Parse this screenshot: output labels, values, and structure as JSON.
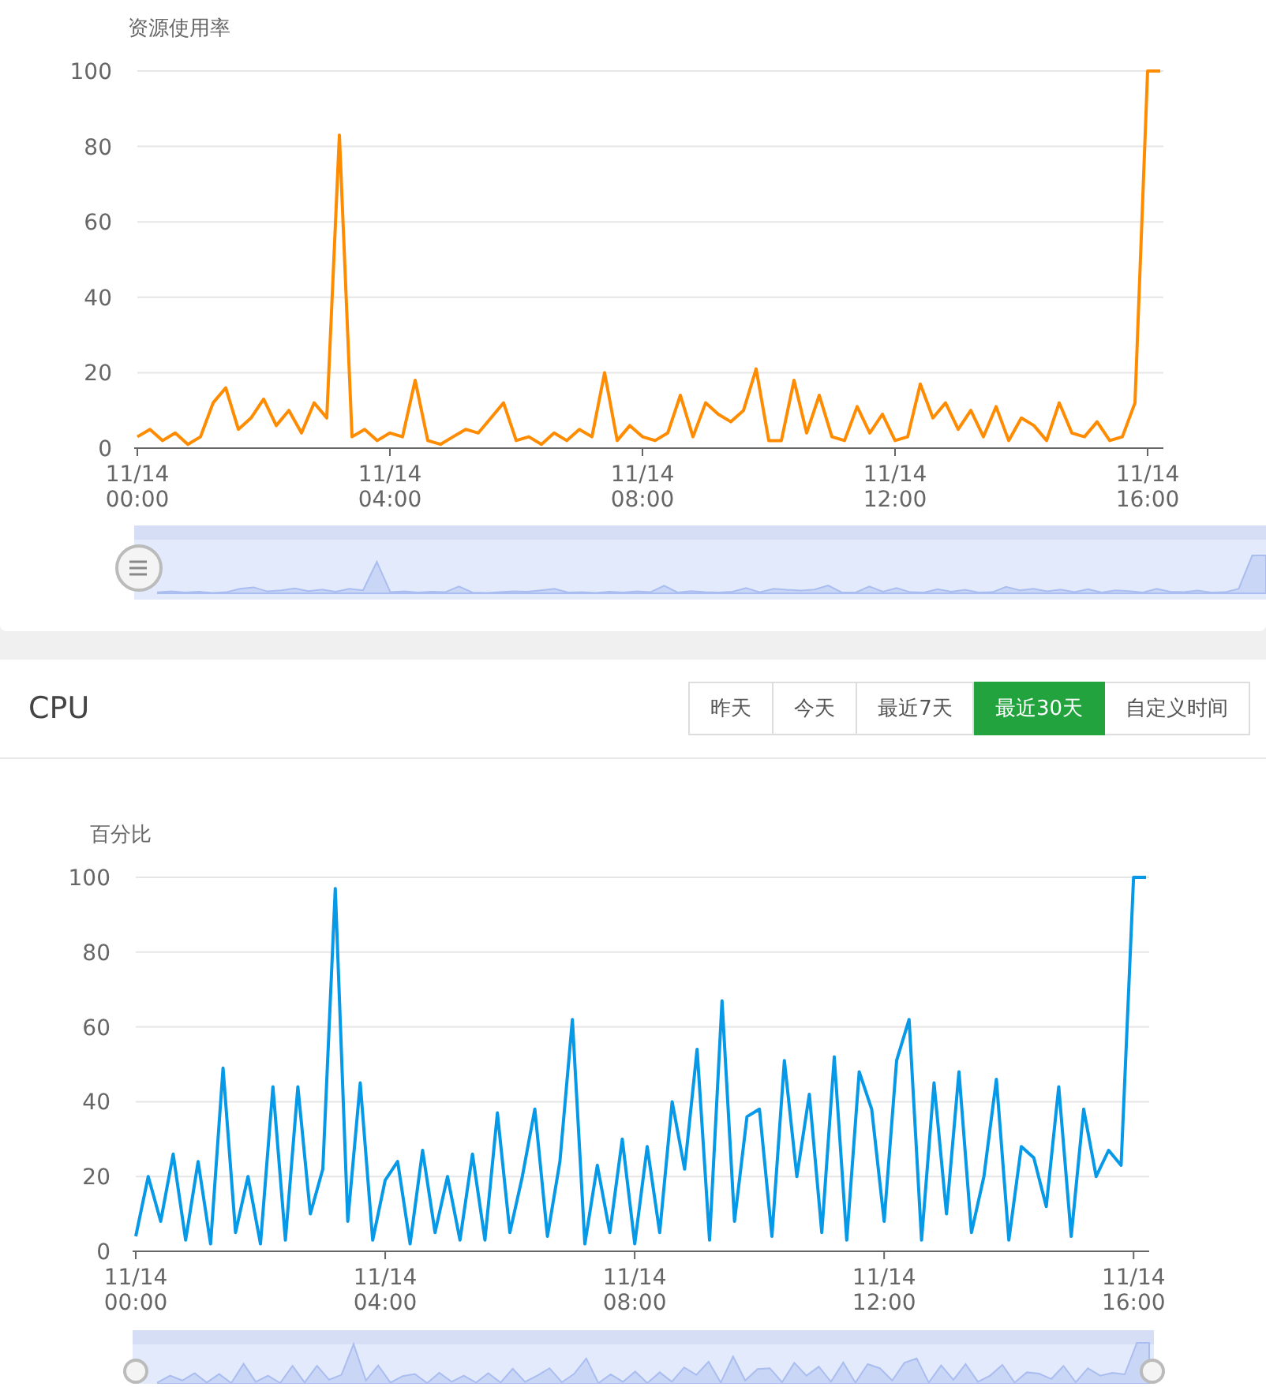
{
  "usage_panel": {
    "chart_data": {
      "type": "line",
      "ylabel": "资源使用率",
      "ylim": [
        0,
        100
      ],
      "grid": true,
      "yticks": [
        0,
        20,
        40,
        60,
        80,
        100
      ],
      "categories": [
        "11/14 00:00",
        null,
        null,
        null,
        null,
        null,
        null,
        null,
        null,
        null,
        null,
        null,
        null,
        null,
        null,
        null,
        null,
        null,
        null,
        null,
        "11/14 04:00",
        null,
        null,
        null,
        null,
        null,
        null,
        null,
        null,
        null,
        null,
        null,
        null,
        null,
        null,
        null,
        null,
        null,
        null,
        null,
        "11/14 08:00",
        null,
        null,
        null,
        null,
        null,
        null,
        null,
        null,
        null,
        null,
        null,
        null,
        null,
        null,
        null,
        null,
        null,
        null,
        null,
        "11/14 12:00",
        null,
        null,
        null,
        null,
        null,
        null,
        null,
        null,
        null,
        null,
        null,
        null,
        null,
        null,
        null,
        null,
        null,
        null,
        null,
        "11/14 16:00",
        null
      ],
      "series": [
        {
          "color": "#ff8c00",
          "values": [
            3,
            5,
            2,
            4,
            1,
            3,
            12,
            16,
            5,
            8,
            13,
            6,
            10,
            4,
            12,
            8,
            83,
            3,
            5,
            2,
            4,
            3,
            18,
            2,
            1,
            3,
            5,
            4,
            8,
            12,
            2,
            3,
            1,
            4,
            2,
            5,
            3,
            20,
            2,
            6,
            3,
            2,
            4,
            14,
            3,
            12,
            9,
            7,
            10,
            21,
            2,
            2,
            18,
            4,
            14,
            3,
            2,
            11,
            4,
            9,
            2,
            3,
            17,
            8,
            12,
            5,
            10,
            3,
            11,
            2,
            8,
            6,
            2,
            12,
            4,
            3,
            7,
            2,
            3,
            12,
            100,
            100
          ]
        }
      ]
    }
  },
  "cpu_panel": {
    "title": "CPU",
    "range_buttons": [
      {
        "label": "昨天",
        "selected": false
      },
      {
        "label": "今天",
        "selected": false
      },
      {
        "label": "最近7天",
        "selected": false
      },
      {
        "label": "最近30天",
        "selected": true
      },
      {
        "label": "自定义时间",
        "selected": false
      }
    ],
    "chart_data": {
      "type": "line",
      "ylabel": "百分比",
      "ylim": [
        0,
        100
      ],
      "grid": true,
      "yticks": [
        0,
        20,
        40,
        60,
        80,
        100
      ],
      "categories": [
        "11/14 00:00",
        null,
        null,
        null,
        null,
        null,
        null,
        null,
        null,
        null,
        null,
        null,
        null,
        null,
        null,
        null,
        null,
        null,
        null,
        null,
        "11/14 04:00",
        null,
        null,
        null,
        null,
        null,
        null,
        null,
        null,
        null,
        null,
        null,
        null,
        null,
        null,
        null,
        null,
        null,
        null,
        null,
        "11/14 08:00",
        null,
        null,
        null,
        null,
        null,
        null,
        null,
        null,
        null,
        null,
        null,
        null,
        null,
        null,
        null,
        null,
        null,
        null,
        null,
        "11/14 12:00",
        null,
        null,
        null,
        null,
        null,
        null,
        null,
        null,
        null,
        null,
        null,
        null,
        null,
        null,
        null,
        null,
        null,
        null,
        null,
        "11/14 16:00",
        null
      ],
      "series": [
        {
          "color": "#0599e8",
          "values": [
            4,
            20,
            8,
            26,
            3,
            24,
            2,
            49,
            5,
            20,
            2,
            44,
            3,
            44,
            10,
            22,
            97,
            8,
            45,
            3,
            19,
            24,
            2,
            27,
            5,
            20,
            3,
            26,
            3,
            37,
            5,
            20,
            38,
            4,
            24,
            62,
            2,
            23,
            5,
            30,
            2,
            28,
            5,
            40,
            22,
            54,
            3,
            67,
            8,
            36,
            38,
            4,
            51,
            20,
            42,
            5,
            52,
            3,
            48,
            38,
            8,
            51,
            62,
            3,
            45,
            10,
            48,
            5,
            20,
            46,
            3,
            28,
            25,
            12,
            44,
            4,
            38,
            20,
            27,
            23,
            100,
            100
          ]
        }
      ]
    }
  }
}
